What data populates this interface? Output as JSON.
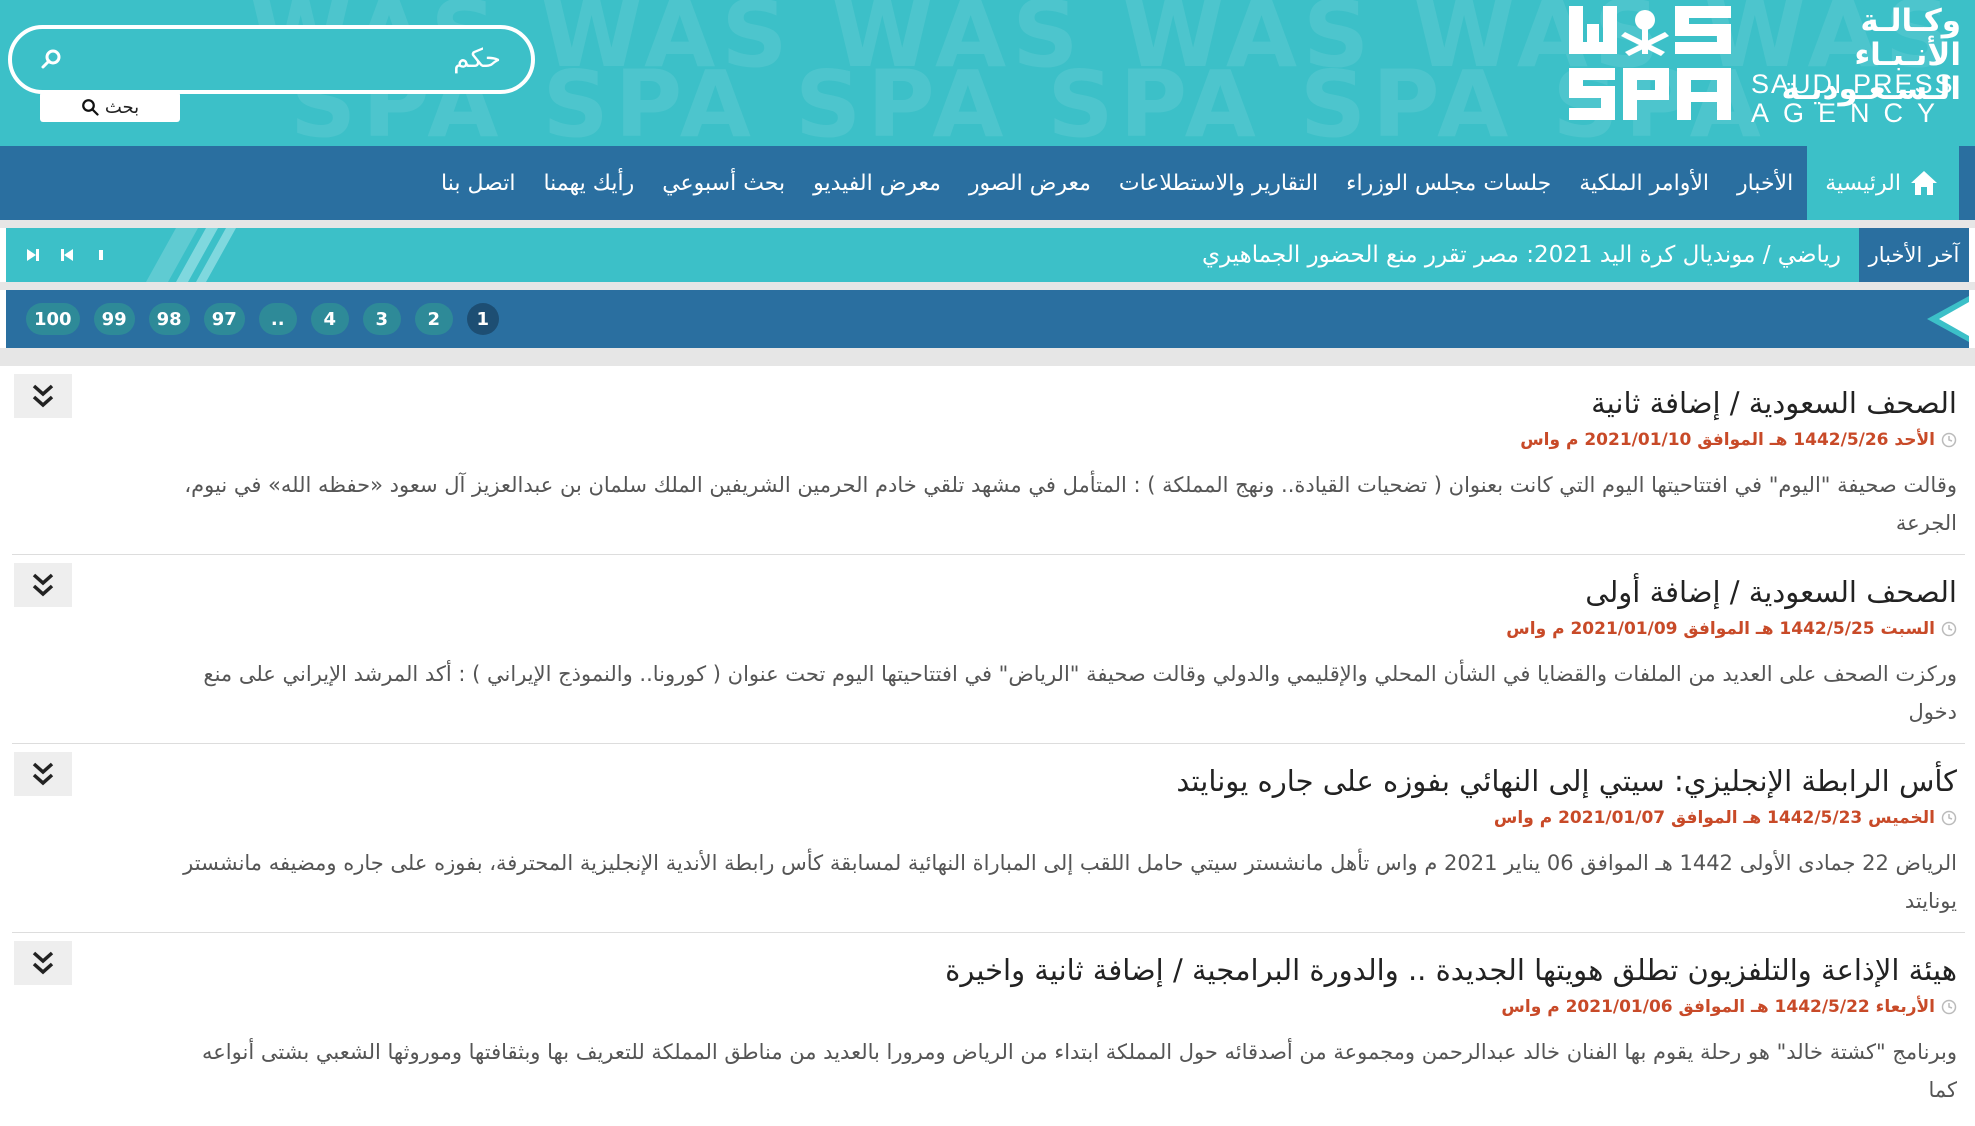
{
  "header": {
    "logo_ar_line1": "وكـالـة الأنـبـاء",
    "logo_ar_line2": "الـسـعـوديـة",
    "logo_en_line1": "SAUDI PRESS",
    "logo_en_line2": "AGENCY",
    "logo_mark_text_top": "WAS",
    "logo_mark_text_bottom": "SPA",
    "search": {
      "value": "حكم",
      "button_label": "بحث"
    }
  },
  "nav": {
    "items": [
      {
        "label": "الرئيسية",
        "icon": "home-icon"
      },
      {
        "label": "الأخبار"
      },
      {
        "label": "الأوامر الملكية"
      },
      {
        "label": "جلسات مجلس الوزراء"
      },
      {
        "label": "التقارير والاستطلاعات"
      },
      {
        "label": "معرض الصور"
      },
      {
        "label": "معرض الفيديو"
      },
      {
        "label": "بحث أسبوعي"
      },
      {
        "label": "رأيك يهمنا"
      },
      {
        "label": "اتصل بنا"
      }
    ]
  },
  "ticker": {
    "label": "آخر الأخبار",
    "text": "رياضي / مونديال كرة اليد 2021: مصر تقرر منع الحضور الجماهيري"
  },
  "pagination": {
    "pages": [
      "1",
      "2",
      "3",
      "4",
      "..",
      "97",
      "98",
      "99",
      "100"
    ],
    "current": "1"
  },
  "articles": [
    {
      "title": "الصحف السعودية / إضافة ثانية",
      "date": "الأحد 1442/5/26 هـ الموافق 2021/01/10 م واس",
      "excerpt": "وقالت صحيفة \"اليوم\" في افتتاحيتها اليوم التي كانت بعنوان ( تضحيات القيادة.. ونهج المملكة ) : المتأمل في مشهد تلقي خادم الحرمين الشريفين الملك سلمان بن عبدالعزيز آل سعود «حفظه الله» في نيوم، الجرعة"
    },
    {
      "title": "الصحف السعودية / إضافة أولى",
      "date": "السبت 1442/5/25 هـ الموافق 2021/01/09 م واس",
      "excerpt": "وركزت الصحف على العديد من الملفات والقضايا في الشأن المحلي والإقليمي والدولي وقالت صحيفة \"الرياض\" في افتتاحيتها اليوم تحت عنوان ( كورونا.. والنموذج الإيراني ) : أكد المرشد الإيراني على منع دخول"
    },
    {
      "title": "كأس الرابطة الإنجليزي: سيتي إلى النهائي بفوزه على جاره يونايتد",
      "date": "الخميس 1442/5/23 هـ الموافق 2021/01/07 م واس",
      "excerpt": "الرياض 22 جمادى الأولى 1442 هـ الموافق 06 يناير 2021 م واس تأهل مانشستر سيتي حامل اللقب إلى المباراة النهائية لمسابقة كأس رابطة الأندية الإنجليزية المحترفة، بفوزه على جاره ومضيفه مانشستر يونايتد"
    },
    {
      "title": "هيئة الإذاعة والتلفزيون تطلق هويتها الجديدة .. والدورة البرامجية / إضافة ثانية واخيرة",
      "date": "الأربعاء 1442/5/22 هـ الموافق 2021/01/06 م واس",
      "excerpt": "وبرنامج \"كشتة خالد\" هو رحلة يقوم بها الفنان خالد عبدالرحمن ومجموعة من أصدقائه حول المملكة ابتداء من الرياض ومرورا بالعديد من مناطق المملكة للتعريف بها وبثقافتها وموروثها الشعبي بشتى أنواعه كما"
    }
  ],
  "colors": {
    "banner": "#3cc0c8",
    "nav": "#2a6fa0",
    "date_text": "#c84a28"
  }
}
